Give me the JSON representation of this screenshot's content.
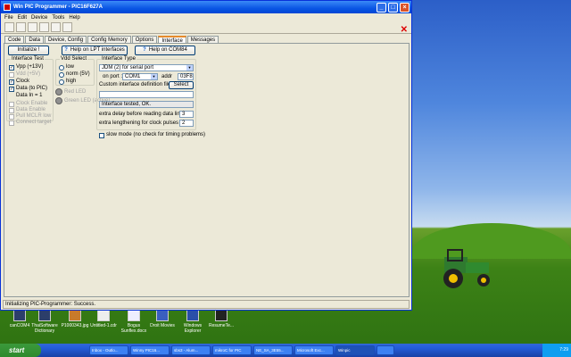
{
  "window": {
    "title": "Win PIC Programmer - PIC16F627A",
    "menu": [
      "File",
      "Edit",
      "Device",
      "Tools",
      "Help"
    ],
    "tabs": [
      "Code",
      "Data",
      "Device, Config",
      "Config Memory",
      "Options",
      "Interface",
      "Messages"
    ],
    "active_tab": "Interface"
  },
  "panel": {
    "initialize_button": "Initialize !",
    "lpt_help_button": "Help on LPT interfaces",
    "com_help_button": "Help on COM84",
    "interface_test": {
      "label": "Interface Test",
      "items": [
        {
          "label": "Vpp (+13V)",
          "checked": true,
          "enabled": true
        },
        {
          "label": "Vdd (+5V)",
          "checked": false,
          "enabled": false
        },
        {
          "label": "Clock",
          "checked": true,
          "enabled": true
        },
        {
          "label": "Data (to PIC)",
          "checked": true,
          "enabled": true
        }
      ],
      "data_in": "Data In = 1",
      "disabled_items": [
        "Clock Enable",
        "Data Enable",
        "Pull MCLR low",
        "Connect target"
      ]
    },
    "vdd_select": {
      "label": "Vdd Select",
      "options": [
        "low",
        "norm (5V)",
        "high"
      ]
    },
    "leds": [
      "Red LED",
      "Green LED (active)"
    ],
    "interface_type": {
      "label": "Interface Type",
      "selected": "JDM (2) for serial port",
      "on_port_label": "on port :",
      "port": "COM1",
      "addr_label": "addr",
      "addr": "03F8",
      "custom_label": "Custom interface definition file:",
      "select_button": "Select",
      "status": "Interface tested, OK."
    },
    "delay_label": "extra delay before reading data line [us]",
    "delay_value": "3",
    "lengthen_label": "extra lengthening for clock pulses [us]",
    "lengthen_value": "2",
    "slow_mode_label": "slow mode (no check for timing problems)"
  },
  "status_bar": "Initializing PIC-Programmer: Success.",
  "desktop_icons": [
    {
      "label": "canCOM4"
    },
    {
      "label": "ThaiSoftware Dictionary"
    },
    {
      "label": "P1000343.jpg"
    },
    {
      "label": "Untitled-1.cdr"
    },
    {
      "label": "Bogus Sunflex.docx"
    },
    {
      "label": "Droit Movies"
    },
    {
      "label": "Windows Explorer"
    },
    {
      "label": "ResumeTe..."
    }
  ],
  "taskbar": {
    "start_label": "start",
    "tasks": [
      "Inbox - Outlo...",
      "Winny PIC16...",
      "sbs3 - Alum...",
      "mikroC for PIC",
      "NE_SA_3E55...",
      "Microsoft Exc...",
      "Winpic",
      ""
    ],
    "active_task": 6,
    "clock": "7:29"
  }
}
